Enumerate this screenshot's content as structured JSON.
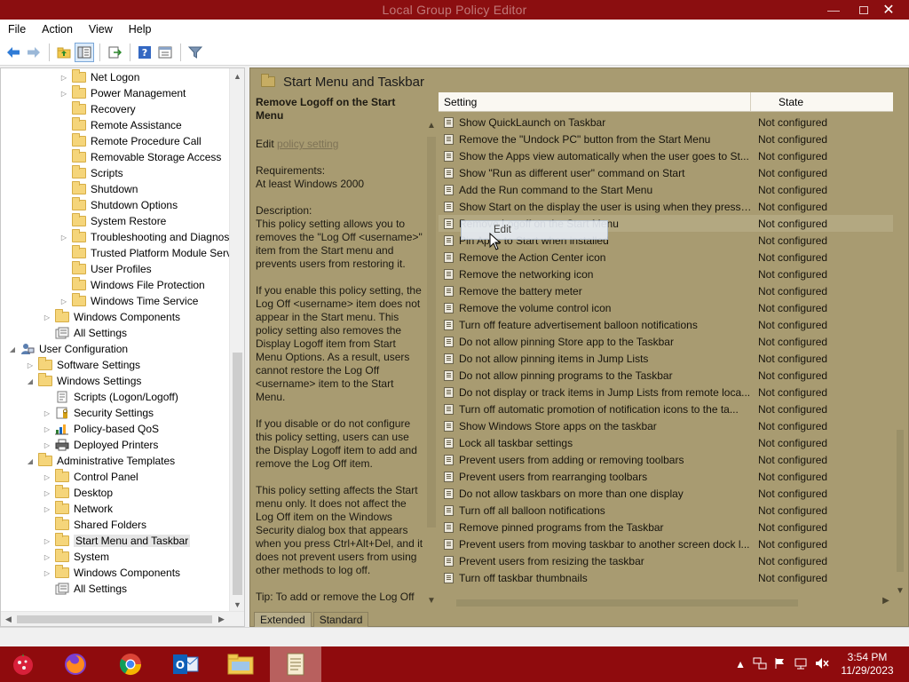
{
  "window": {
    "title": "Local Group Policy Editor"
  },
  "menu": [
    "File",
    "Action",
    "View",
    "Help"
  ],
  "tree": [
    {
      "label": "Net Logon",
      "level": 4,
      "expander": true,
      "icon": "folder-icon"
    },
    {
      "label": "Power Management",
      "level": 4,
      "expander": true,
      "icon": "folder-icon"
    },
    {
      "label": "Recovery",
      "level": 4,
      "expander": false,
      "icon": "folder-icon"
    },
    {
      "label": "Remote Assistance",
      "level": 4,
      "expander": false,
      "icon": "folder-icon"
    },
    {
      "label": "Remote Procedure Call",
      "level": 4,
      "expander": false,
      "icon": "folder-icon"
    },
    {
      "label": "Removable Storage Access",
      "level": 4,
      "expander": false,
      "icon": "folder-icon"
    },
    {
      "label": "Scripts",
      "level": 4,
      "expander": false,
      "icon": "folder-icon"
    },
    {
      "label": "Shutdown",
      "level": 4,
      "expander": false,
      "icon": "folder-icon"
    },
    {
      "label": "Shutdown Options",
      "level": 4,
      "expander": false,
      "icon": "folder-icon"
    },
    {
      "label": "System Restore",
      "level": 4,
      "expander": false,
      "icon": "folder-icon"
    },
    {
      "label": "Troubleshooting and Diagnos",
      "level": 4,
      "expander": true,
      "icon": "folder-icon"
    },
    {
      "label": "Trusted Platform Module Serv",
      "level": 4,
      "expander": false,
      "icon": "folder-icon"
    },
    {
      "label": "User Profiles",
      "level": 4,
      "expander": false,
      "icon": "folder-icon"
    },
    {
      "label": "Windows File Protection",
      "level": 4,
      "expander": false,
      "icon": "folder-icon"
    },
    {
      "label": "Windows Time Service",
      "level": 4,
      "expander": true,
      "icon": "folder-icon"
    },
    {
      "label": "Windows Components",
      "level": 3,
      "expander": true,
      "icon": "folder-icon"
    },
    {
      "label": "All Settings",
      "level": 3,
      "expander": false,
      "icon": "all-settings-icon"
    },
    {
      "label": "User Configuration",
      "level": 1,
      "expander": "open",
      "icon": "user-config-icon"
    },
    {
      "label": "Software Settings",
      "level": 2,
      "expander": true,
      "icon": "folder-icon"
    },
    {
      "label": "Windows Settings",
      "level": 2,
      "expander": "open",
      "icon": "folder-icon"
    },
    {
      "label": "Scripts (Logon/Logoff)",
      "level": 3,
      "expander": false,
      "icon": "scripts-icon"
    },
    {
      "label": "Security Settings",
      "level": 3,
      "expander": true,
      "icon": "security-icon"
    },
    {
      "label": "Policy-based QoS",
      "level": 3,
      "expander": true,
      "icon": "qos-chart-icon"
    },
    {
      "label": "Deployed Printers",
      "level": 3,
      "expander": true,
      "icon": "printer-icon"
    },
    {
      "label": "Administrative Templates",
      "level": 2,
      "expander": "open",
      "icon": "folder-icon"
    },
    {
      "label": "Control Panel",
      "level": 3,
      "expander": true,
      "icon": "folder-icon"
    },
    {
      "label": "Desktop",
      "level": 3,
      "expander": true,
      "icon": "folder-icon"
    },
    {
      "label": "Network",
      "level": 3,
      "expander": true,
      "icon": "folder-icon"
    },
    {
      "label": "Shared Folders",
      "level": 3,
      "expander": false,
      "icon": "folder-icon"
    },
    {
      "label": "Start Menu and Taskbar",
      "level": 3,
      "expander": true,
      "icon": "folder-icon",
      "selected": true
    },
    {
      "label": "System",
      "level": 3,
      "expander": true,
      "icon": "folder-icon"
    },
    {
      "label": "Windows Components",
      "level": 3,
      "expander": true,
      "icon": "folder-icon"
    },
    {
      "label": "All Settings",
      "level": 3,
      "expander": false,
      "icon": "all-settings-icon"
    }
  ],
  "pane": {
    "title": "Start Menu and Taskbar",
    "description": {
      "heading": "Remove Logoff on the Start Menu",
      "edit_prefix": "Edit ",
      "edit_link": "policy setting",
      "requirements_label": "Requirements:",
      "requirements": "At least Windows 2000",
      "description_label": "Description:",
      "paragraphs": [
        "This policy setting allows you to removes the \"Log Off <username>\" item from the Start menu and prevents users from restoring it.",
        "If you enable this policy setting, the Log Off <username> item does not appear in the Start menu. This policy setting also removes the Display Logoff item from Start Menu Options. As a result, users cannot restore the Log Off <username> item to the Start Menu.",
        "If you disable or do not configure this policy setting, users can use the Display Logoff item to add and remove the Log Off item.",
        "This policy setting affects the Start menu only. It does not affect the Log Off item on the Windows Security dialog box that appears when you press Ctrl+Alt+Del, and it does not prevent users from using other methods to log off.",
        "Tip: To add or remove the Log Off"
      ]
    },
    "columns": {
      "setting": "Setting",
      "state": "State"
    },
    "settings": [
      {
        "name": "Show QuickLaunch on Taskbar",
        "state": "Not configured"
      },
      {
        "name": "Remove the \"Undock PC\" button from the Start Menu",
        "state": "Not configured"
      },
      {
        "name": "Show the Apps view automatically when the user goes to St...",
        "state": "Not configured"
      },
      {
        "name": "Show \"Run as different user\" command on Start",
        "state": "Not configured"
      },
      {
        "name": "Add the Run command to the Start Menu",
        "state": "Not configured"
      },
      {
        "name": "Show Start on the display the user is using when they press t...",
        "state": "Not configured"
      },
      {
        "name": "Remove Logoff on the Start Menu",
        "state": "Not configured",
        "highlighted": true
      },
      {
        "name": "Pin Apps to Start when installed",
        "state": "Not configured"
      },
      {
        "name": "Remove the Action Center icon",
        "state": "Not configured"
      },
      {
        "name": "Remove the networking icon",
        "state": "Not configured"
      },
      {
        "name": "Remove the battery meter",
        "state": "Not configured"
      },
      {
        "name": "Remove the volume control icon",
        "state": "Not configured"
      },
      {
        "name": "Turn off feature advertisement balloon notifications",
        "state": "Not configured"
      },
      {
        "name": "Do not allow pinning Store app to the Taskbar",
        "state": "Not configured"
      },
      {
        "name": "Do not allow pinning items in Jump Lists",
        "state": "Not configured"
      },
      {
        "name": "Do not allow pinning programs to the Taskbar",
        "state": "Not configured"
      },
      {
        "name": "Do not display or track items in Jump Lists from remote loca...",
        "state": "Not configured"
      },
      {
        "name": "Turn off automatic promotion of notification icons to the ta...",
        "state": "Not configured"
      },
      {
        "name": "Show Windows Store apps on the taskbar",
        "state": "Not configured"
      },
      {
        "name": "Lock all taskbar settings",
        "state": "Not configured"
      },
      {
        "name": "Prevent users from adding or removing toolbars",
        "state": "Not configured"
      },
      {
        "name": "Prevent users from rearranging toolbars",
        "state": "Not configured"
      },
      {
        "name": "Do not allow taskbars on more than one display",
        "state": "Not configured"
      },
      {
        "name": "Turn off all balloon notifications",
        "state": "Not configured"
      },
      {
        "name": "Remove pinned programs from the Taskbar",
        "state": "Not configured"
      },
      {
        "name": "Prevent users from moving taskbar to another screen dock l...",
        "state": "Not configured"
      },
      {
        "name": "Prevent users from resizing the taskbar",
        "state": "Not configured"
      },
      {
        "name": "Turn off taskbar thumbnails",
        "state": "Not configured"
      }
    ],
    "tabs": [
      "Extended",
      "Standard"
    ],
    "context_menu": {
      "item": "Edit"
    }
  },
  "taskbar": {
    "apps": [
      {
        "name": "start-button-icon"
      },
      {
        "name": "firefox-icon"
      },
      {
        "name": "chrome-icon"
      },
      {
        "name": "outlook-icon"
      },
      {
        "name": "file-explorer-icon"
      },
      {
        "name": "group-policy-editor-icon",
        "active": true
      }
    ],
    "clock": {
      "time": "3:54 PM",
      "date": "11/29/2023"
    }
  },
  "colors": {
    "taskbar": "#8f0b0d",
    "titlebar": "#8b0e10",
    "dimmed_pane": "#a89b71"
  }
}
